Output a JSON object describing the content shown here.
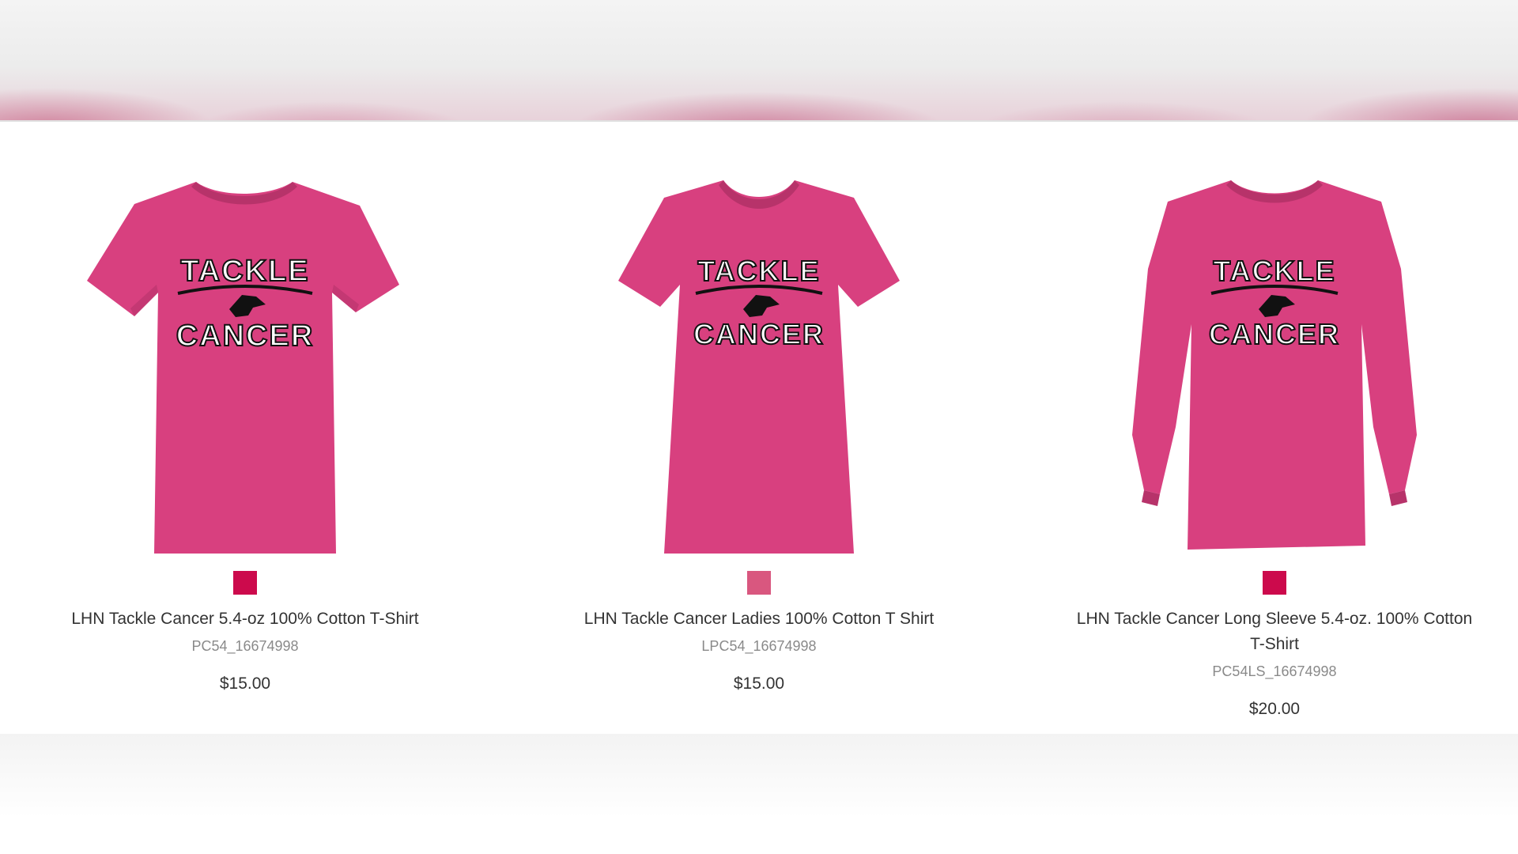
{
  "colors": {
    "shirt": "#d8407f",
    "shirt_shadow": "#b7336a",
    "swatch_1": "#cc0a4c",
    "swatch_2": "#d9577f",
    "swatch_3": "#cc0a4c",
    "logo_text": "#ffffff",
    "logo_outline": "#111111"
  },
  "icons": {
    "logo": "horse-head-icon",
    "laces": "football-laces-icon"
  },
  "products": [
    {
      "name": "LHN Tackle Cancer 5.4-oz 100% Cotton T-Shirt",
      "sku": "PC54_16674998",
      "price": "$15.00",
      "swatch_color": "#cc0a4c",
      "logo_line1": "TACKLE",
      "logo_line2": "CANCER"
    },
    {
      "name": "LHN Tackle Cancer Ladies 100% Cotton T Shirt",
      "sku": "LPC54_16674998",
      "price": "$15.00",
      "swatch_color": "#d9577f",
      "logo_line1": "TACKLE",
      "logo_line2": "CANCER"
    },
    {
      "name": "LHN Tackle Cancer Long Sleeve 5.4-oz. 100% Cotton T-Shirt",
      "sku": "PC54LS_16674998",
      "price": "$20.00",
      "swatch_color": "#cc0a4c",
      "logo_line1": "TACKLE",
      "logo_line2": "CANCER"
    }
  ]
}
